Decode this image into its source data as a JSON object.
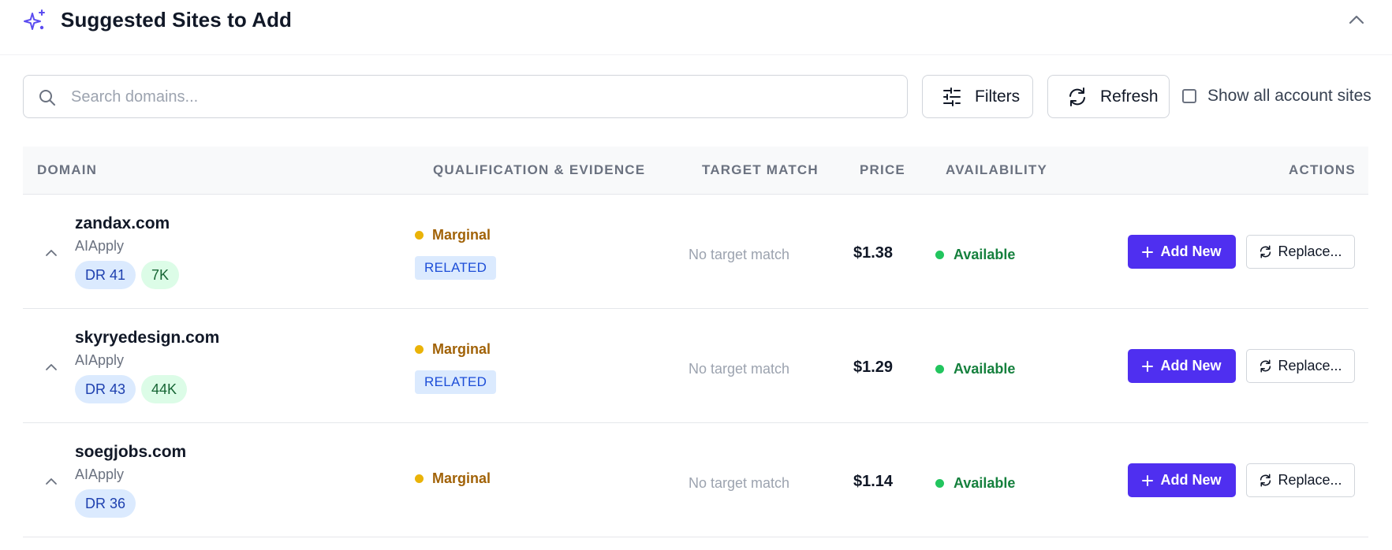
{
  "header": {
    "title": "Suggested Sites to Add",
    "icon": "sparkle-icon",
    "accent": "#5b4cf0"
  },
  "toolbar": {
    "search_placeholder": "Search domains...",
    "search_value": "",
    "filters_label": "Filters",
    "refresh_label": "Refresh",
    "show_all_label": "Show all account sites",
    "show_all_checked": false
  },
  "table": {
    "columns": [
      "DOMAIN",
      "QUALIFICATION & EVIDENCE",
      "TARGET MATCH",
      "PRICE",
      "AVAILABILITY",
      "ACTIONS"
    ],
    "rows": [
      {
        "domain": "zandax.com",
        "account": "AIApply",
        "dr": "DR 41",
        "traffic": "7K",
        "qualification": "Marginal",
        "evidence": "RELATED",
        "target_match": "No target match",
        "price": "$1.38",
        "availability": "Available",
        "add_label": "Add New",
        "replace_label": "Replace..."
      },
      {
        "domain": "skyryedesign.com",
        "account": "AIApply",
        "dr": "DR 43",
        "traffic": "44K",
        "qualification": "Marginal",
        "evidence": "RELATED",
        "target_match": "No target match",
        "price": "$1.29",
        "availability": "Available",
        "add_label": "Add New",
        "replace_label": "Replace..."
      },
      {
        "domain": "soegjobs.com",
        "account": "AIApply",
        "dr": "DR 36",
        "traffic": "",
        "qualification": "Marginal",
        "evidence": "",
        "target_match": "No target match",
        "price": "$1.14",
        "availability": "Available",
        "add_label": "Add New",
        "replace_label": "Replace..."
      }
    ]
  },
  "colors": {
    "primary_button": "#4f2ff0",
    "marginal": "#a16207",
    "available": "#15803d",
    "dr_badge": "#dbeafe",
    "traffic_badge": "#dcfce7"
  }
}
